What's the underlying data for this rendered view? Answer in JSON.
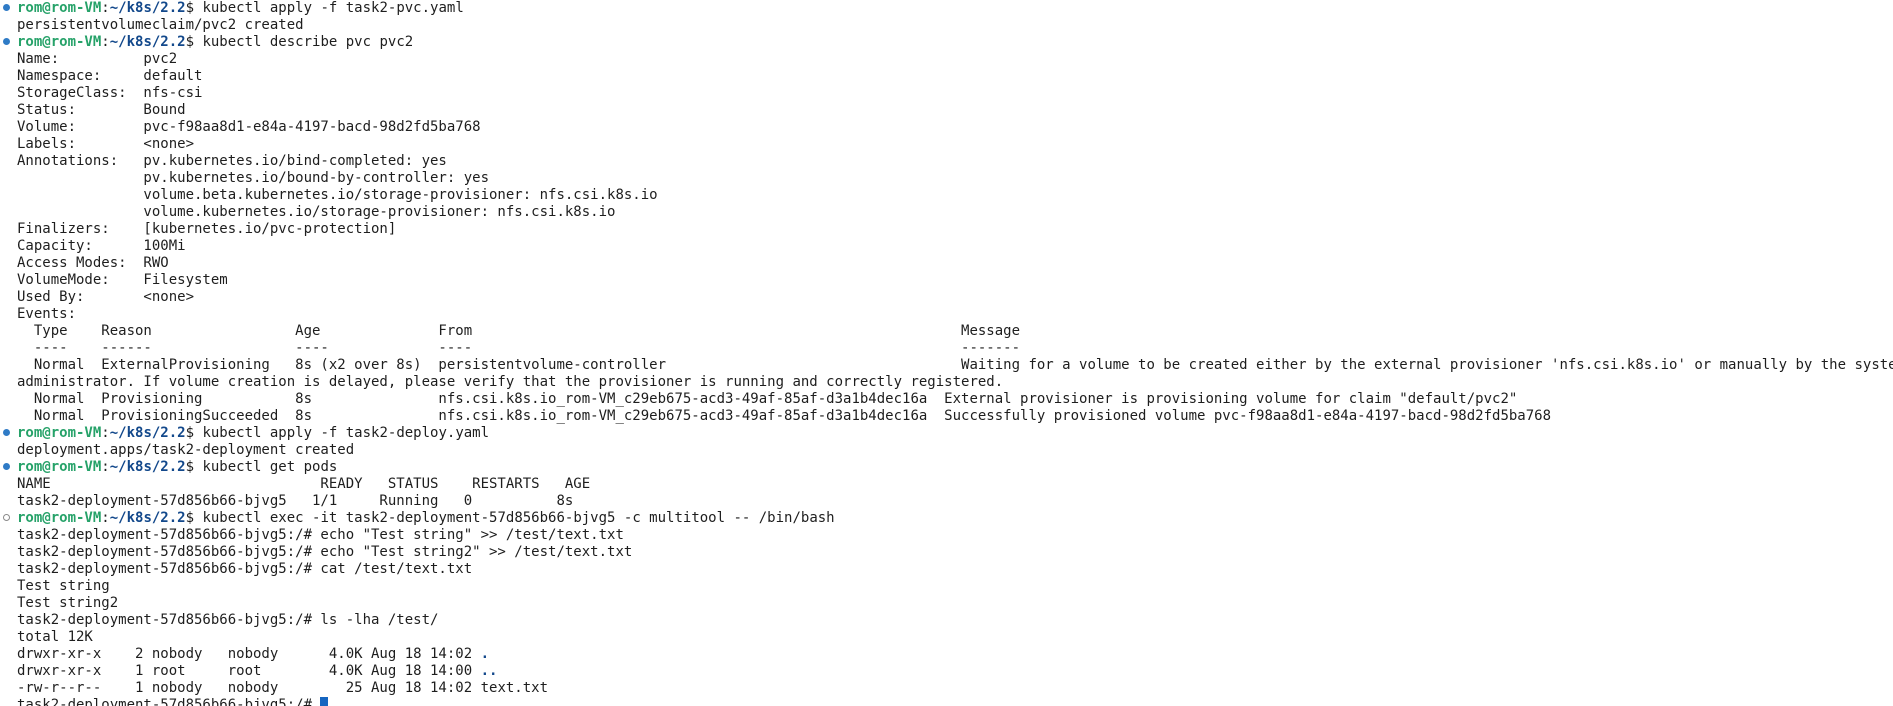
{
  "prompt": {
    "user_host": "rom@rom-VM",
    "colon": ":",
    "path": "~/k8s/2.2",
    "symbol": "$ "
  },
  "lines": [
    {
      "kind": "prompt",
      "marker": "done",
      "command": "kubectl apply -f task2-pvc.yaml"
    },
    {
      "kind": "output",
      "text": "persistentvolumeclaim/pvc2 created"
    },
    {
      "kind": "prompt",
      "marker": "done",
      "command": "kubectl describe pvc pvc2"
    },
    {
      "kind": "output",
      "text": "Name:          pvc2"
    },
    {
      "kind": "output",
      "text": "Namespace:     default"
    },
    {
      "kind": "output",
      "text": "StorageClass:  nfs-csi"
    },
    {
      "kind": "output",
      "text": "Status:        Bound"
    },
    {
      "kind": "output",
      "text": "Volume:        pvc-f98aa8d1-e84a-4197-bacd-98d2fd5ba768"
    },
    {
      "kind": "output",
      "text": "Labels:        <none>"
    },
    {
      "kind": "output",
      "text": "Annotations:   pv.kubernetes.io/bind-completed: yes"
    },
    {
      "kind": "output",
      "text": "               pv.kubernetes.io/bound-by-controller: yes"
    },
    {
      "kind": "output",
      "text": "               volume.beta.kubernetes.io/storage-provisioner: nfs.csi.k8s.io"
    },
    {
      "kind": "output",
      "text": "               volume.kubernetes.io/storage-provisioner: nfs.csi.k8s.io"
    },
    {
      "kind": "output",
      "text": "Finalizers:    [kubernetes.io/pvc-protection]"
    },
    {
      "kind": "output",
      "text": "Capacity:      100Mi"
    },
    {
      "kind": "output",
      "text": "Access Modes:  RWO"
    },
    {
      "kind": "output",
      "text": "VolumeMode:    Filesystem"
    },
    {
      "kind": "output",
      "text": "Used By:       <none>"
    },
    {
      "kind": "output",
      "text": "Events:"
    },
    {
      "kind": "output",
      "text": "  Type    Reason                 Age              From                                                          Message"
    },
    {
      "kind": "output",
      "text": "  ----    ------                 ----             ----                                                          -------"
    },
    {
      "kind": "output",
      "text": "  Normal  ExternalProvisioning   8s (x2 over 8s)  persistentvolume-controller                                   Waiting for a volume to be created either by the external provisioner 'nfs.csi.k8s.io' or manually by the system"
    },
    {
      "kind": "output",
      "text": "administrator. If volume creation is delayed, please verify that the provisioner is running and correctly registered."
    },
    {
      "kind": "output",
      "text": "  Normal  Provisioning           8s               nfs.csi.k8s.io_rom-VM_c29eb675-acd3-49af-85af-d3a1b4dec16a  External provisioner is provisioning volume for claim \"default/pvc2\""
    },
    {
      "kind": "output",
      "text": "  Normal  ProvisioningSucceeded  8s               nfs.csi.k8s.io_rom-VM_c29eb675-acd3-49af-85af-d3a1b4dec16a  Successfully provisioned volume pvc-f98aa8d1-e84a-4197-bacd-98d2fd5ba768"
    },
    {
      "kind": "prompt",
      "marker": "done",
      "command": "kubectl apply -f task2-deploy.yaml"
    },
    {
      "kind": "output",
      "text": "deployment.apps/task2-deployment created"
    },
    {
      "kind": "prompt",
      "marker": "done",
      "command": "kubectl get pods"
    },
    {
      "kind": "output",
      "text": "NAME                                READY   STATUS    RESTARTS   AGE"
    },
    {
      "kind": "output",
      "text": "task2-deployment-57d856b66-bjvg5   1/1     Running   0          8s"
    },
    {
      "kind": "prompt",
      "marker": "open",
      "command": "kubectl exec -it task2-deployment-57d856b66-bjvg5 -c multitool -- /bin/bash"
    },
    {
      "kind": "output",
      "text": "task2-deployment-57d856b66-bjvg5:/# echo \"Test string\" >> /test/text.txt"
    },
    {
      "kind": "output",
      "text": "task2-deployment-57d856b66-bjvg5:/# echo \"Test string2\" >> /test/text.txt"
    },
    {
      "kind": "output",
      "text": "task2-deployment-57d856b66-bjvg5:/# cat /test/text.txt"
    },
    {
      "kind": "output",
      "text": "Test string"
    },
    {
      "kind": "output",
      "text": "Test string2"
    },
    {
      "kind": "output",
      "text": "task2-deployment-57d856b66-bjvg5:/# ls -lha /test/"
    },
    {
      "kind": "output",
      "text": "total 12K"
    },
    {
      "kind": "ls",
      "text": "drwxr-xr-x    2 nobody   nobody      4.0K Aug 18 14:02 ",
      "name": ".",
      "name_class": "dirname"
    },
    {
      "kind": "ls",
      "text": "drwxr-xr-x    1 root     root        4.0K Aug 18 14:00 ",
      "name": "..",
      "name_class": "dirname"
    },
    {
      "kind": "ls",
      "text": "-rw-r--r--    1 nobody   nobody        25 Aug 18 14:02 ",
      "name": "text.txt",
      "name_class": ""
    },
    {
      "kind": "cursor",
      "text": "task2-deployment-57d856b66-bjvg5:/# "
    }
  ]
}
